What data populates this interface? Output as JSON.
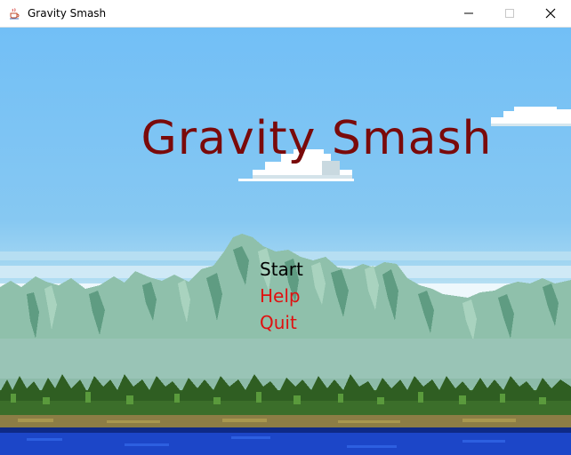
{
  "window": {
    "title": "Gravity Smash",
    "icon": "java-cup-icon",
    "controls": [
      "minimize-icon",
      "maximize-icon",
      "close-icon"
    ]
  },
  "game": {
    "title": "Gravity Smash",
    "title_color": "#7a0a0a",
    "menu": [
      {
        "label": "Start",
        "color": "#000000",
        "selected": true
      },
      {
        "label": "Help",
        "color": "#e01010",
        "selected": false
      },
      {
        "label": "Quit",
        "color": "#e01010",
        "selected": false
      }
    ]
  },
  "colors": {
    "sky_top": "#74c0f5",
    "sky_mid": "#9ed3f0",
    "haze": "#e6f4fb",
    "mountain": "#8fc0ab",
    "mountain_dark": "#5f9c82",
    "mountain_base": "#99c4b6",
    "forest": "#3b6e2a",
    "forest_light": "#5a9a3c",
    "ground": "#8c7d45",
    "water": "#1c46c8",
    "water_dark": "#0e2a86"
  }
}
